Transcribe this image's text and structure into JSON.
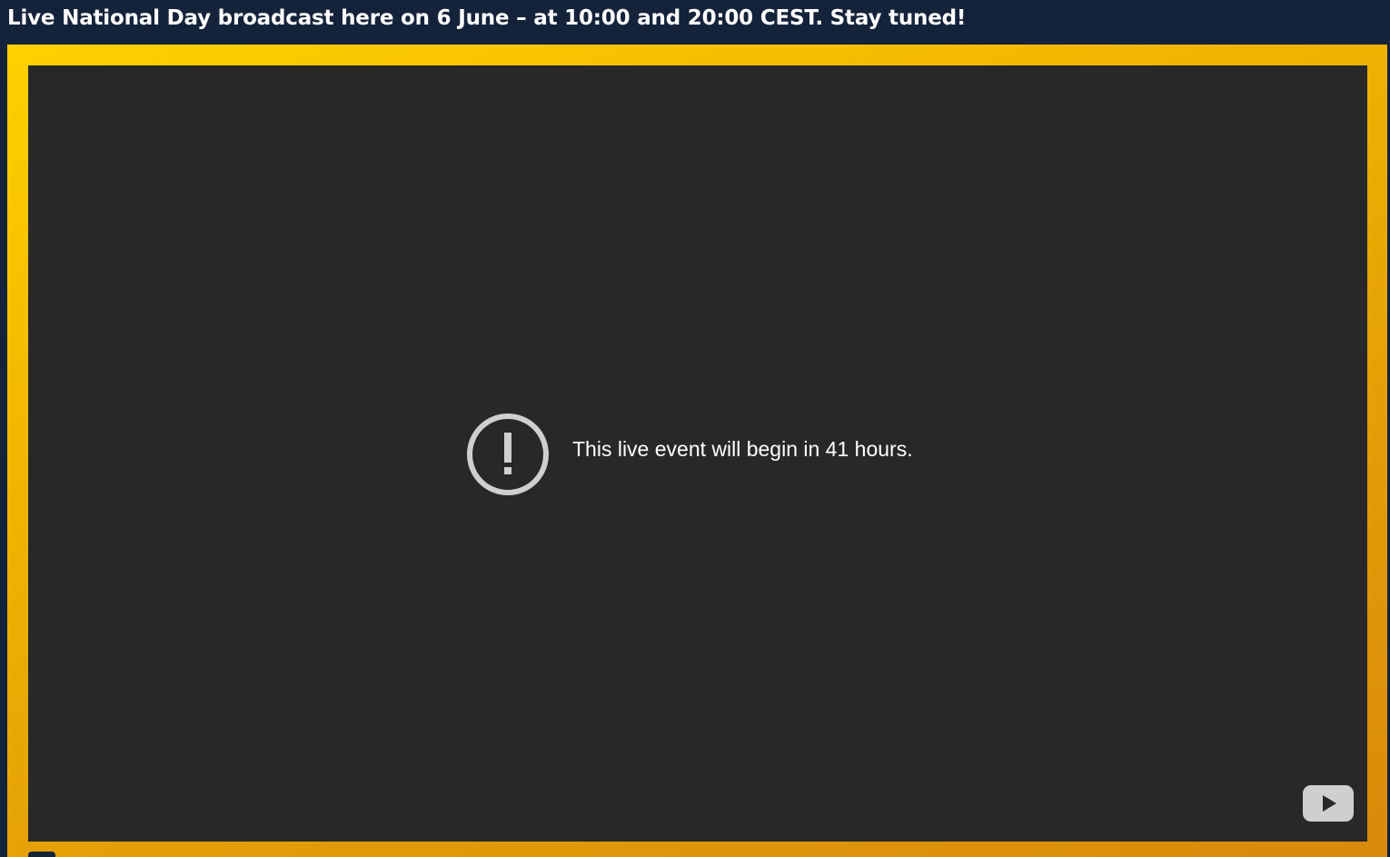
{
  "banner": {
    "text": "Live National Day broadcast here on 6 June – at 10:00 and 20:00 CEST. Stay tuned!"
  },
  "player": {
    "status_message": "This live event will begin in 41 hours.",
    "status_icon": "alert-circle-icon",
    "brand_icon": "youtube-play-icon"
  },
  "colors": {
    "banner_bg": "#14233a",
    "frame_gradient_start": "#ffd100",
    "frame_gradient_end": "#d88a0a",
    "player_bg": "#282828",
    "icon_gray": "#cfcfcf"
  }
}
